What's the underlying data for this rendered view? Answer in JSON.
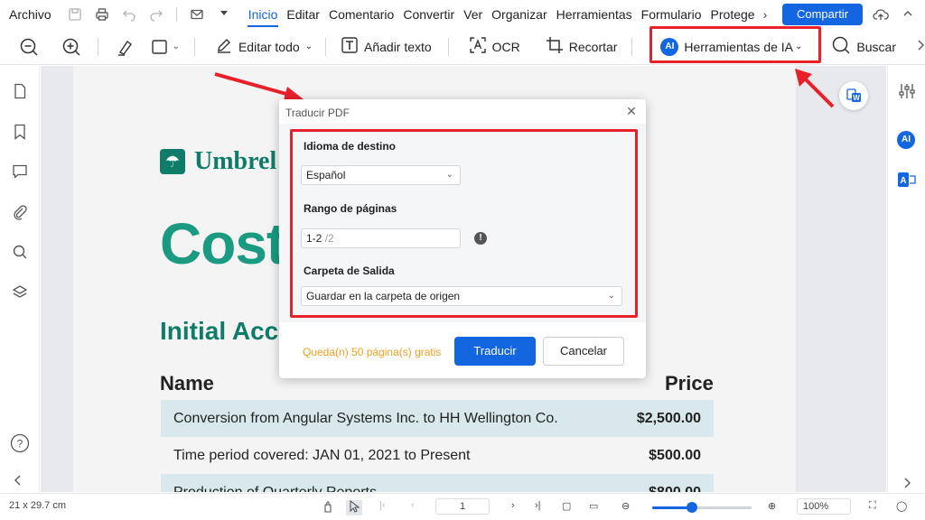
{
  "menubar": {
    "archivo": "Archivo",
    "tabs": [
      "Inicio",
      "Editar",
      "Comentario",
      "Convertir",
      "Ver",
      "Organizar",
      "Herramientas",
      "Formulario",
      "Protege"
    ],
    "more": "›",
    "share": "Compartir"
  },
  "toolbar": {
    "edit_all": "Editar todo",
    "add_text": "Añadir texto",
    "ocr": "OCR",
    "crop": "Recortar",
    "ai_badge": "AI",
    "ai_tools": "Herramientas de IA",
    "search": "Buscar"
  },
  "document": {
    "logo_text": "Umbrel",
    "title_fragment": "Cost",
    "subtitle_fragment": "Initial Acc",
    "col_name": "Name",
    "col_price": "Price",
    "rows": [
      {
        "name": "Conversion from Angular Systems Inc. to HH Wellington Co.",
        "price": "$2,500.00"
      },
      {
        "name": "Time period covered: JAN 01, 2021 to Present",
        "price": "$500.00"
      },
      {
        "name": "Production of Quarterly Reports",
        "price": "$800.00"
      }
    ]
  },
  "dialog": {
    "title": "Traducir PDF",
    "lang_label": "Idioma de destino",
    "lang_value": "Español",
    "range_label": "Rango de páginas",
    "range_value": "1-2",
    "range_total": "/2",
    "output_label": "Carpeta de Salida",
    "output_value": "Guardar en la carpeta de origen",
    "free_pages": "Queda(n) 50 página(s) gratis",
    "translate_btn": "Traducir",
    "cancel_btn": "Cancelar"
  },
  "sidebar_right": {
    "ai_badge": "AI"
  },
  "statusbar": {
    "dimensions": "21 x 29.7 cm",
    "page_current": "1",
    "zoom": "100%",
    "zoom_fraction": 0.4
  },
  "colors": {
    "accent": "#1465e0",
    "highlight": "#e8202a",
    "brand": "#0e7c68"
  }
}
